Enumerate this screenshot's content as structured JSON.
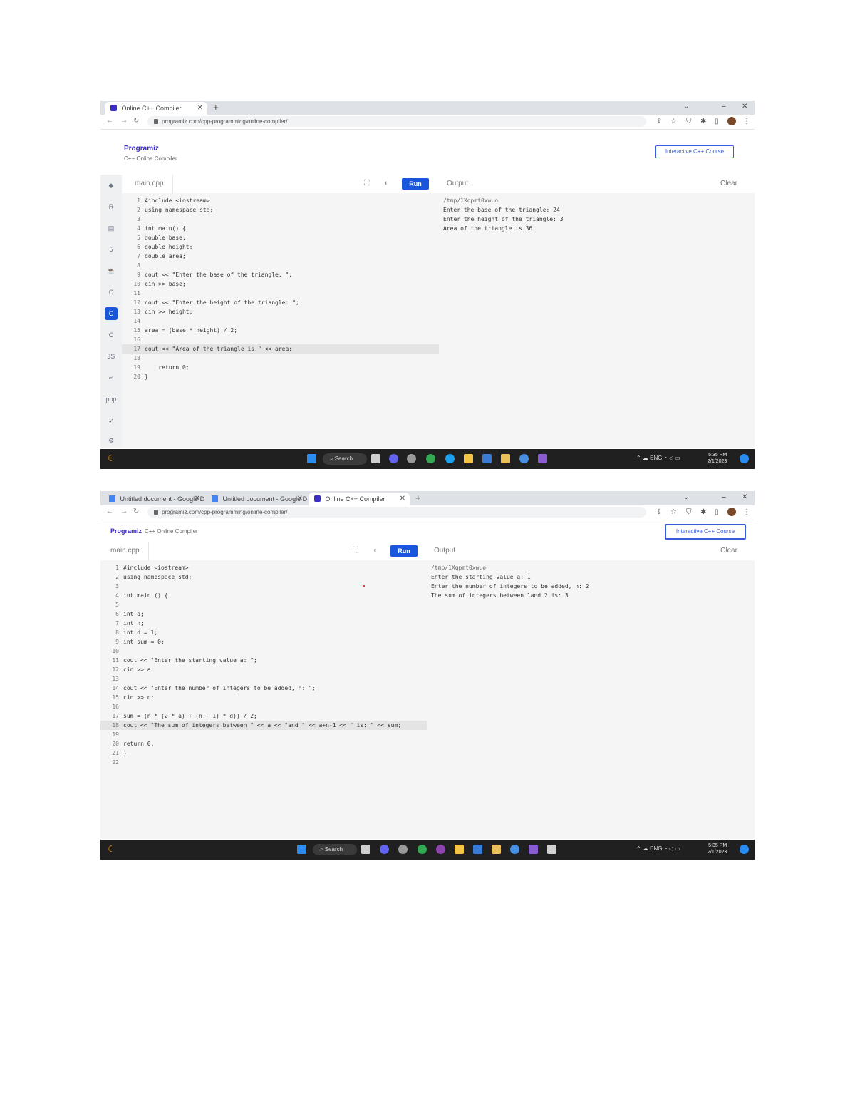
{
  "screenshot1": {
    "tabs": [
      {
        "title": "Online C++ Compiler",
        "active": true
      }
    ],
    "address_url": "programiz.com/cpp-programming/online-compiler/",
    "brand_name": "Programiz",
    "brand_subtitle": "C++ Online Compiler",
    "course_button": "Interactive C++ Course",
    "file_tab": "main.cpp",
    "run_label": "Run",
    "output_label": "Output",
    "clear_label": "Clear",
    "code_lines": [
      {
        "n": "1",
        "text": "#include <iostream>"
      },
      {
        "n": "2",
        "text": "using namespace std;"
      },
      {
        "n": "3",
        "text": ""
      },
      {
        "n": "4",
        "text": "int main() {"
      },
      {
        "n": "5",
        "text": "double base;"
      },
      {
        "n": "6",
        "text": "double height;"
      },
      {
        "n": "7",
        "text": "double area;"
      },
      {
        "n": "8",
        "text": ""
      },
      {
        "n": "9",
        "text": "cout << \"Enter the base of the triangle: \";"
      },
      {
        "n": "10",
        "text": "cin >> base;"
      },
      {
        "n": "11",
        "text": ""
      },
      {
        "n": "12",
        "text": "cout << \"Enter the height of the triangle: \";"
      },
      {
        "n": "13",
        "text": "cin >> height;"
      },
      {
        "n": "14",
        "text": ""
      },
      {
        "n": "15",
        "text": "area = (base * height) / 2;"
      },
      {
        "n": "16",
        "text": ""
      },
      {
        "n": "17",
        "text": "cout << \"Area of the triangle is \" << area;"
      },
      {
        "n": "18",
        "text": ""
      },
      {
        "n": "19",
        "text": "    return 0;"
      },
      {
        "n": "20",
        "text": "}"
      }
    ],
    "highlighted_line": 17,
    "output_lines": [
      "/tmp/1Xqpmt0xw.o",
      "Enter the base of the triangle: 24",
      "Enter the height of the triangle: 3",
      "Area of the triangle is 36"
    ],
    "taskbar_search": "Search",
    "tray_text": "ENG",
    "clock_time": "5:35 PM",
    "clock_date": "2/1/2023"
  },
  "screenshot2": {
    "tabs": [
      {
        "title": "Untitled document - Google Docs",
        "active": false
      },
      {
        "title": "Untitled document - Google Docs",
        "active": false
      },
      {
        "title": "Online C++ Compiler",
        "active": true
      }
    ],
    "address_url": "programiz.com/cpp-programming/online-compiler/",
    "brand_name": "Programiz",
    "brand_subtitle": "C++ Online Compiler",
    "course_button": "Interactive C++ Course",
    "file_tab": "main.cpp",
    "run_label": "Run",
    "output_label": "Output",
    "clear_label": "Clear",
    "code_lines": [
      {
        "n": "1",
        "text": "#include <iostream>"
      },
      {
        "n": "2",
        "text": "using namespace std;"
      },
      {
        "n": "3",
        "text": ""
      },
      {
        "n": "4",
        "text": "int main () {"
      },
      {
        "n": "5",
        "text": ""
      },
      {
        "n": "6",
        "text": "int a;"
      },
      {
        "n": "7",
        "text": "int n;"
      },
      {
        "n": "8",
        "text": "int d = 1;"
      },
      {
        "n": "9",
        "text": "int sum = 0;"
      },
      {
        "n": "10",
        "text": ""
      },
      {
        "n": "11",
        "text": "cout << \"Enter the starting value a: \";"
      },
      {
        "n": "12",
        "text": "cin >> a;"
      },
      {
        "n": "13",
        "text": ""
      },
      {
        "n": "14",
        "text": "cout << \"Enter the number of integers to be added, n: \";"
      },
      {
        "n": "15",
        "text": "cin >> n;"
      },
      {
        "n": "16",
        "text": ""
      },
      {
        "n": "17",
        "text": "sum = (n * (2 * a) + (n - 1) * d)) / 2;"
      },
      {
        "n": "18",
        "text": "cout << \"The sum of integers between \" << a << \"and \" << a+n-1 << \" is: \" << sum;"
      },
      {
        "n": "19",
        "text": ""
      },
      {
        "n": "20",
        "text": "return 0;"
      },
      {
        "n": "21",
        "text": "}"
      },
      {
        "n": "22",
        "text": ""
      }
    ],
    "highlighted_line": 18,
    "output_lines": [
      "/tmp/1Xqpmt0xw.o",
      "Enter the starting value a: 1",
      "Enter the number of integers to be added, n: 2",
      "The sum of integers between 1and 2 is: 3"
    ],
    "taskbar_search": "Search",
    "tray_text": "ENG",
    "clock_time": "5:35 PM",
    "clock_date": "2/1/2023"
  },
  "colors": {
    "run_button": "#1a56db",
    "brand": "#3b2cc8",
    "taskbar": "#202020",
    "editor_bg": "#f5f5f5"
  },
  "sidebar_icons": [
    "python-icon",
    "r-icon",
    "sql-icon",
    "html-icon",
    "java-icon",
    "c-icon",
    "cpp-icon",
    "csharp-icon",
    "js-icon",
    "go-icon",
    "php-icon",
    "swift-icon",
    "rust-icon"
  ]
}
